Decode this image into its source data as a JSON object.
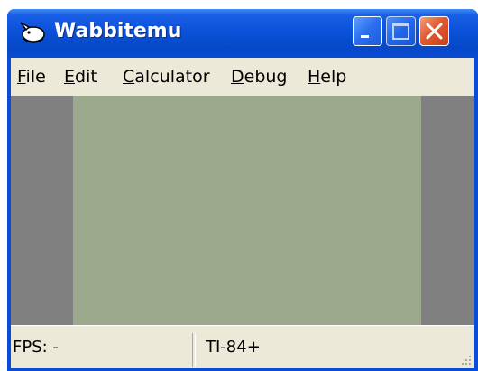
{
  "window": {
    "title": "Wabbitemu",
    "icon": "rabbit-icon"
  },
  "title_buttons": {
    "minimize": "minimize-icon",
    "maximize": "maximize-icon",
    "close": "close-icon"
  },
  "menu": {
    "items": [
      {
        "mnemonic": "F",
        "rest": "ile"
      },
      {
        "mnemonic": "E",
        "rest": "dit"
      },
      {
        "mnemonic": "C",
        "rest": "alculator"
      },
      {
        "mnemonic": "D",
        "rest": "ebug"
      },
      {
        "mnemonic": "H",
        "rest": "elp"
      }
    ]
  },
  "status": {
    "fps": "FPS: -",
    "model": "TI-84+"
  },
  "colors": {
    "titlebar": "#0a52d9",
    "menubar": "#ece9d8",
    "lcd": "#9ca98c",
    "client": "#808080"
  }
}
